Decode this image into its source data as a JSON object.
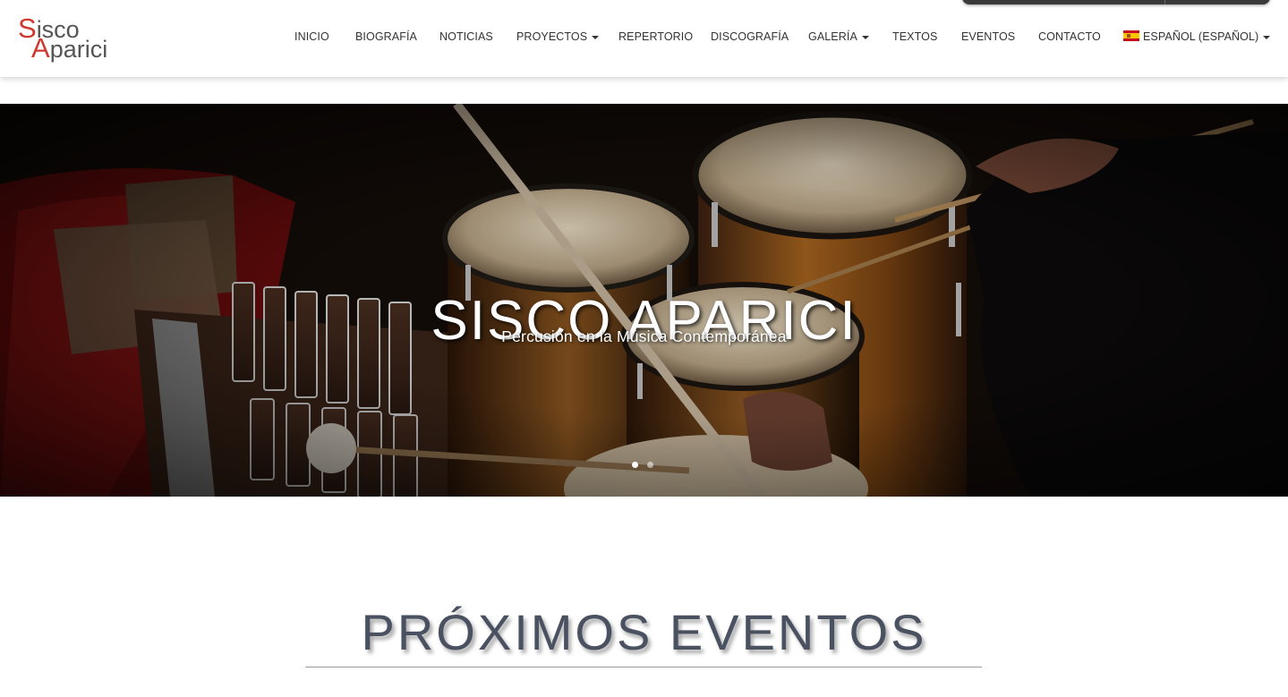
{
  "logo": {
    "line1_cap": "S",
    "line1_rest": "isco",
    "line2_cap": "A",
    "line2_rest": "parici"
  },
  "nav": {
    "items": [
      {
        "label": "INICIO",
        "dropdown": false
      },
      {
        "label": "BIOGRAFÍA",
        "dropdown": false
      },
      {
        "label": "NOTICIAS",
        "dropdown": false
      },
      {
        "label": "PROYECTOS",
        "dropdown": true
      },
      {
        "label": "REPERTORIO",
        "dropdown": false
      },
      {
        "label": "DISCOGRAFÍA",
        "dropdown": false
      },
      {
        "label": "GALERÍA",
        "dropdown": true
      },
      {
        "label": "TEXTOS",
        "dropdown": false
      },
      {
        "label": "EVENTOS",
        "dropdown": false
      },
      {
        "label": "CONTACTO",
        "dropdown": false
      }
    ],
    "language": {
      "label": "ESPAÑOL (ESPAÑOL)",
      "flag_icon": "spain-flag-icon"
    }
  },
  "hero": {
    "title": "SISCO APARICI",
    "subtitle": "Percusión en la Música Contemporánea",
    "slides": 2,
    "active_slide": 1
  },
  "events": {
    "heading": "PRÓXIMOS EVENTOS"
  },
  "colors": {
    "accent": "#d0392f",
    "nav_text": "#333333",
    "heading": "#4a5160"
  }
}
